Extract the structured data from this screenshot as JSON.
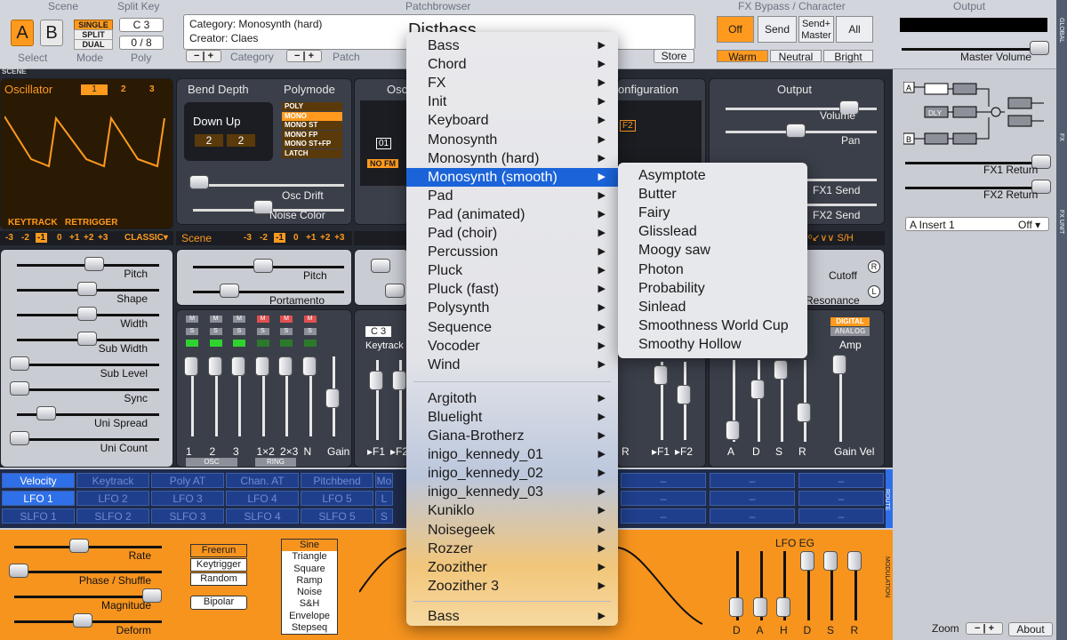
{
  "topbar": {
    "scene": {
      "title": "Scene",
      "a": "A",
      "b": "B",
      "select_label": "Select"
    },
    "mode": {
      "single": "SINGLE",
      "split": "SPLIT",
      "dual": "DUAL",
      "label": "Mode"
    },
    "split_key": {
      "title": "Split Key",
      "value": "C 3",
      "poly_value": "0 / 8",
      "poly_label": "Poly"
    },
    "patchbrowser": {
      "title": "Patchbrowser",
      "category": "Category: Monosynth (hard)",
      "creator": "Creator: Claes",
      "patch_name": "Distbass",
      "category_label": "Category",
      "patch_label": "Patch",
      "store": "Store",
      "minus": "−",
      "plus": "+"
    },
    "fx_bypass": {
      "title": "FX Bypass / Character",
      "off": "Off",
      "send": "Send",
      "send_master": "Send+ Master",
      "all": "All",
      "warm": "Warm",
      "neutral": "Neutral",
      "bright": "Bright"
    },
    "output": {
      "title": "Output",
      "master_volume": "Master Volume"
    }
  },
  "scene_label": "SCENE",
  "oscillator": {
    "title": "Oscillator",
    "tabs": [
      "1",
      "2",
      "3"
    ],
    "keytrack": "KEYTRACK",
    "retrigger": "RETRIGGER",
    "octaves": [
      "-3",
      "-2",
      "-1",
      "0",
      "+1",
      "+2",
      "+3"
    ],
    "type": "CLASSIC▾",
    "sliders": [
      "Pitch",
      "Shape",
      "Width",
      "Sub Width",
      "Sub Level",
      "Sync",
      "Uni Spread",
      "Uni Count"
    ]
  },
  "bend": {
    "title": "Bend Depth",
    "values": "Down Up",
    "down": "2",
    "up": "2",
    "polymode_title": "Polymode",
    "polymodes": [
      "POLY",
      "MONO",
      "MONO ST",
      "MONO FP",
      "MONO ST+FP",
      "LATCH"
    ],
    "osc_drift": "Osc Drift",
    "noise_color": "Noise Color"
  },
  "scene_pitch": {
    "title": "Scene",
    "octaves": [
      "-3",
      "-2",
      "-1",
      "0",
      "+1",
      "+2",
      "+3"
    ],
    "pitch": "Pitch",
    "portamento": "Portamento"
  },
  "mixer": {
    "channels": [
      "1",
      "2",
      "3",
      "1×2",
      "2×3",
      "N",
      "Gain"
    ],
    "osc_tag": "OSC",
    "ring_tag": "RING",
    "m": "M",
    "s": "S"
  },
  "osc_routing": {
    "title": "Osc",
    "nofm": "NO FM",
    "value": "01"
  },
  "filter": {
    "c3": "C 3",
    "keytrack": "Keytrack",
    "labels": [
      "▸F1",
      "▸F2"
    ]
  },
  "config": {
    "title": "onfiguration",
    "f2": "F2",
    "labels": [
      "R",
      "▸F1",
      "▸F2"
    ]
  },
  "outputp": {
    "title": "Output",
    "volume": "Volume",
    "pan": "Pan",
    "fx1": "FX1 Send",
    "fx2": "FX2 Send",
    "cutoff": "Cutoff",
    "resonance": "Resonance",
    "digital": "DIGITAL",
    "analog": "ANALOG",
    "amp": "Amp",
    "adsr": [
      "A",
      "D",
      "S",
      "R",
      "Gain Vel"
    ],
    "wave": "ᵒ↙∨∨ S/H",
    "r_badge": "R",
    "l_badge": "L"
  },
  "routing": {
    "row1": [
      "Velocity",
      "Keytrack",
      "Poly AT",
      "Chan. AT",
      "Pitchbend",
      "Mo"
    ],
    "row2": [
      "LFO 1",
      "LFO 2",
      "LFO 3",
      "LFO 4",
      "LFO 5",
      "L"
    ],
    "row3": [
      "SLFO 1",
      "SLFO 2",
      "SLFO 3",
      "SLFO 4",
      "SLFO 5",
      "S"
    ],
    "dash": "–",
    "route": "ROUTE"
  },
  "modulation": {
    "sliders": [
      "Rate",
      "Phase / Shuffle",
      "Magnitude",
      "Deform"
    ],
    "trig": [
      "Freerun",
      "Keytrigger",
      "Random"
    ],
    "bipolar": "Bipolar",
    "shapes": [
      "Sine",
      "Triangle",
      "Square",
      "Ramp",
      "Noise",
      "S&H",
      "Envelope",
      "Stepseq"
    ],
    "lfo_eg": "LFO EG",
    "eg_labels": [
      "D",
      "A",
      "H",
      "D",
      "S",
      "R"
    ],
    "label": "MODULATION"
  },
  "rightpanel": {
    "fx1_return": "FX1 Return",
    "fx2_return": "FX2 Return",
    "insert": "A Insert 1",
    "insert_val": "Off ▾",
    "zoom": "Zoom",
    "about": "About",
    "dly": "DLY",
    "a": "A",
    "b": "B"
  },
  "side_tabs": [
    "GLOBAL",
    "FX",
    "FX UNIT"
  ],
  "menu": {
    "items": [
      "Bass",
      "Chord",
      "FX",
      "Init",
      "Keyboard",
      "Monosynth",
      "Monosynth (hard)",
      "Monosynth (smooth)",
      "Pad",
      "Pad (animated)",
      "Pad (choir)",
      "Percussion",
      "Pluck",
      "Pluck (fast)",
      "Polysynth",
      "Sequence",
      "Vocoder",
      "Wind"
    ],
    "authors": [
      "Argitoth",
      "Bluelight",
      "Giana-Brotherz",
      "inigo_kennedy_01",
      "inigo_kennedy_02",
      "inigo_kennedy_03",
      "Kuniklo",
      "Noisegeek",
      "Rozzer",
      "Zoozither",
      "Zoozither 3"
    ],
    "last": "Bass",
    "selected_index": 7,
    "arrow": "▶"
  },
  "submenu": {
    "items": [
      "Asymptote",
      "Butter",
      "Fairy",
      "Glisslead",
      "Moogy saw",
      "Photon",
      "Probability",
      "Sinlead",
      "Smoothness World Cup",
      "Smoothy Hollow"
    ]
  }
}
